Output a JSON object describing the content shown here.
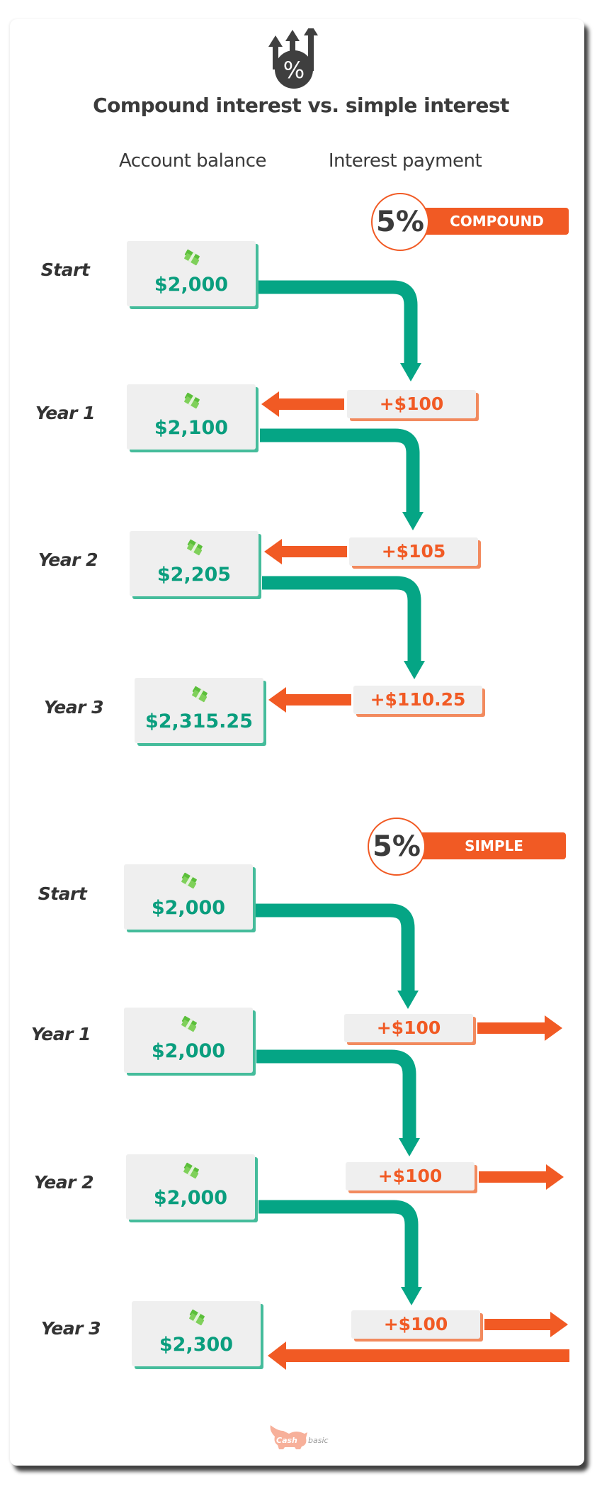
{
  "title": "Compound interest vs. simple interest",
  "header_icon": "percent-growth-arrows-icon",
  "columns": {
    "balance": "Account balance",
    "interest": "Interest payment"
  },
  "colors": {
    "green": "#05a585",
    "orange": "#f15a24",
    "box": "#efefef",
    "text": "#3b3b3b"
  },
  "compound": {
    "rate": "5%",
    "type": "COMPOUND",
    "rows": [
      {
        "label": "Start",
        "balance": "$2,000"
      },
      {
        "label": "Year 1",
        "balance": "$2,100",
        "interest": "+$100"
      },
      {
        "label": "Year 2",
        "balance": "$2,205",
        "interest": "+$105"
      },
      {
        "label": "Year 3",
        "balance": "$2,315.25",
        "interest": "+$110.25"
      }
    ]
  },
  "simple": {
    "rate": "5%",
    "type": "SIMPLE",
    "rows": [
      {
        "label": "Start",
        "balance": "$2,000"
      },
      {
        "label": "Year 1",
        "balance": "$2,000",
        "interest": "+$100"
      },
      {
        "label": "Year 2",
        "balance": "$2,000",
        "interest": "+$100"
      },
      {
        "label": "Year 3",
        "balance": "$2,300",
        "interest": "+$100"
      }
    ]
  },
  "logo": {
    "text_cash": "Cash",
    "text_basic": "basic"
  }
}
